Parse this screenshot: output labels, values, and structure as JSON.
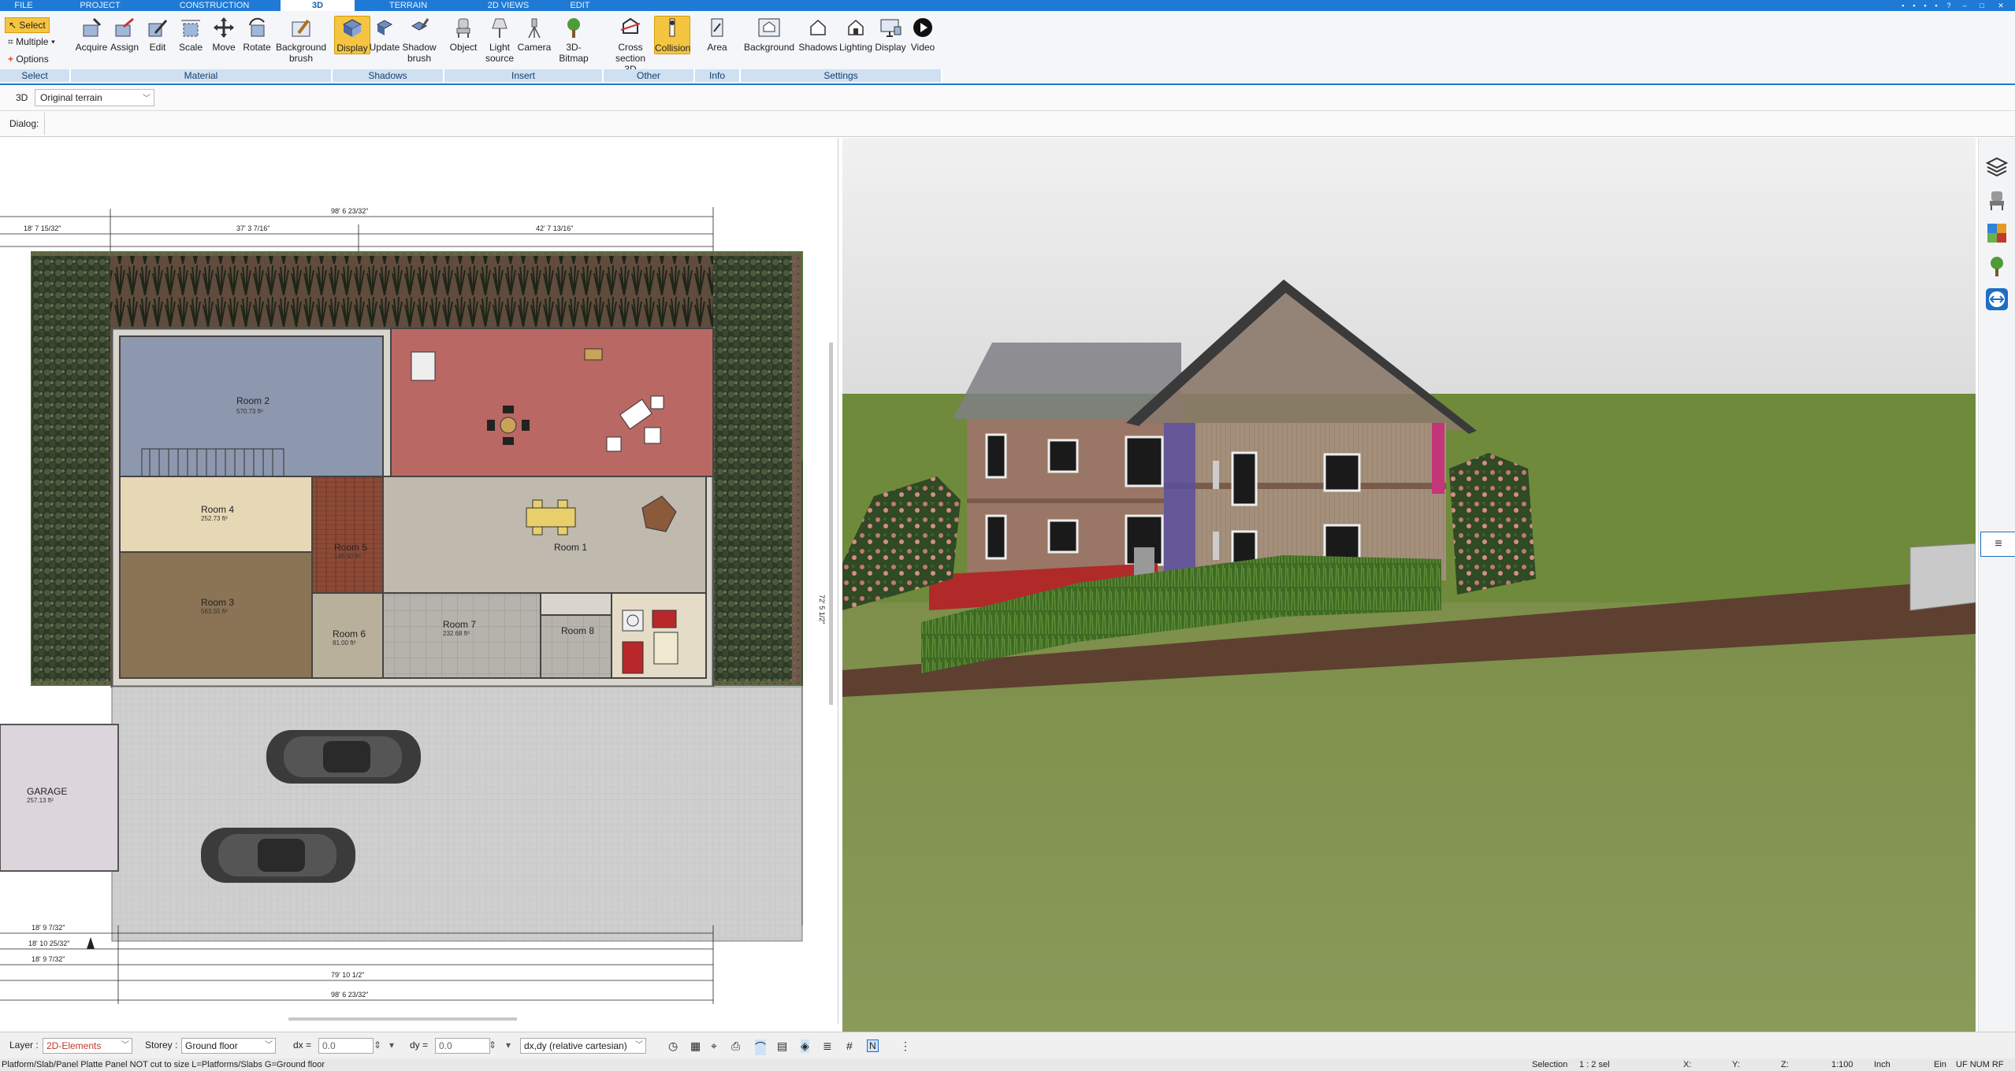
{
  "menu": {
    "tabs": [
      "FILE",
      "PROJECT",
      "CONSTRUCTION",
      "3D",
      "TERRAIN",
      "2D VIEWS",
      "EDIT"
    ],
    "active": "3D"
  },
  "ribbon": {
    "select": {
      "select_label": "Select",
      "multiple_label": "Multiple",
      "options_label": "Options",
      "group": "Select"
    },
    "material": {
      "buttons": [
        "Acquire",
        "Assign",
        "Edit",
        "Scale",
        "Move",
        "Rotate",
        "Background brush"
      ],
      "group": "Material"
    },
    "shadows": {
      "buttons": [
        "Display",
        "Update",
        "Shadow brush"
      ],
      "group": "Shadows"
    },
    "insert": {
      "buttons": [
        "Object",
        "Light source",
        "Camera",
        "3D-Bitmap"
      ],
      "group": "Insert"
    },
    "other": {
      "buttons": [
        "Cross section 3D",
        "Collision"
      ],
      "group": "Other"
    },
    "info": {
      "buttons": [
        "Area"
      ],
      "group": "Info"
    },
    "settings": {
      "buttons": [
        "Background",
        "Shadows",
        "Lighting",
        "Display",
        "Video"
      ],
      "group": "Settings"
    }
  },
  "viewbar": {
    "mode": "3D",
    "terrain": "Original terrain"
  },
  "dialogbar": {
    "label": "Dialog:"
  },
  "plan": {
    "rooms": [
      {
        "name": "Room 2",
        "area": "570.73 ft²"
      },
      {
        "name": "Room 4",
        "area": "252.73 ft²"
      },
      {
        "name": "Room 3",
        "area": "563.55 ft²"
      },
      {
        "name": "Room 5",
        "area": "146.50 ft²"
      },
      {
        "name": "Room 1",
        "area": ""
      },
      {
        "name": "Room 6",
        "area": "81.00 ft²"
      },
      {
        "name": "Room 7",
        "area": "232.68 ft²"
      },
      {
        "name": "Room 8",
        "area": ""
      },
      {
        "name": "GARAGE",
        "area": "257.13 ft²"
      }
    ],
    "dims": {
      "top_total": "98' 6 23/32\"",
      "top_left": "37' 3 7/16\"",
      "top_right": "42' 7 13/16\"",
      "top_outer_left": "18' 7 15/32\"",
      "bottom_total": "98' 6 23/32\"",
      "bottom_mid": "79' 10 1/2\"",
      "bottom_left": "18' 9 7/32\"",
      "bottom_left2": "18' 10 25/32\"",
      "bottom_left3": "18' 9 7/32\"",
      "side_right": "72' 5 1/2\""
    }
  },
  "bottombar": {
    "layer_label": "Layer :",
    "layer_value": "2D-Elements",
    "storey_label": "Storey :",
    "storey_value": "Ground floor",
    "dx_label": "dx =",
    "dx_value": "0.0",
    "dy_label": "dy =",
    "dy_value": "0.0",
    "coord_mode": "dx,dy (relative cartesian)"
  },
  "statusbar": {
    "message": "Platform/Slab/Panel Platte Panel NOT cut to size L=Platforms/Slabs G=Ground floor",
    "selection": "Selection",
    "sel_count": "1 : 2 sel",
    "x": "X:",
    "y": "Y:",
    "z": "Z:",
    "scale": "1:100",
    "unit": "Inch",
    "ein": "Ein",
    "flags": "UF NUM RF"
  },
  "colors": {
    "accent": "#1f7ad6",
    "active_button": "#f5c542",
    "room_red": "#b96864",
    "room_blue": "#8d97ae",
    "grass": "#6f8a3a"
  }
}
